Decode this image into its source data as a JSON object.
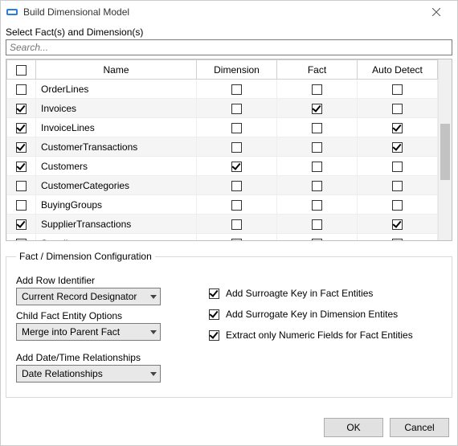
{
  "window": {
    "title": "Build Dimensional Model"
  },
  "selector": {
    "label": "Select Fact(s) and Dimension(s)",
    "search_placeholder": "Search...",
    "headers": {
      "name": "Name",
      "dimension": "Dimension",
      "fact": "Fact",
      "auto": "Auto Detect"
    },
    "rows": [
      {
        "selected": false,
        "name": "OrderLines",
        "dimension": false,
        "fact": false,
        "auto": false
      },
      {
        "selected": true,
        "name": "Invoices",
        "dimension": false,
        "fact": true,
        "auto": false
      },
      {
        "selected": true,
        "name": "InvoiceLines",
        "dimension": false,
        "fact": false,
        "auto": true
      },
      {
        "selected": true,
        "name": "CustomerTransactions",
        "dimension": false,
        "fact": false,
        "auto": true
      },
      {
        "selected": true,
        "name": "Customers",
        "dimension": true,
        "fact": false,
        "auto": false
      },
      {
        "selected": false,
        "name": "CustomerCategories",
        "dimension": false,
        "fact": false,
        "auto": false
      },
      {
        "selected": false,
        "name": "BuyingGroups",
        "dimension": false,
        "fact": false,
        "auto": false
      },
      {
        "selected": true,
        "name": "SupplierTransactions",
        "dimension": false,
        "fact": false,
        "auto": true
      },
      {
        "selected": true,
        "name": "Suppliers",
        "dimension": true,
        "fact": false,
        "auto": false
      }
    ]
  },
  "config": {
    "legend": "Fact / Dimension Configuration",
    "row_id_label": "Add Row Identifier",
    "row_id_value": "Current Record Designator",
    "child_fact_label": "Child Fact Entity Options",
    "child_fact_value": "Merge into Parent Fact",
    "datetime_label": "Add Date/Time Relationships",
    "datetime_value": "Date Relationships",
    "opt_surrogate_fact": {
      "checked": true,
      "label": "Add Surroagte Key in Fact Entities"
    },
    "opt_surrogate_dim": {
      "checked": true,
      "label": "Add Surrogate Key in Dimension Entites"
    },
    "opt_numeric_only": {
      "checked": true,
      "label": "Extract only Numeric Fields for Fact Entities"
    }
  },
  "footer": {
    "ok": "OK",
    "cancel": "Cancel"
  }
}
